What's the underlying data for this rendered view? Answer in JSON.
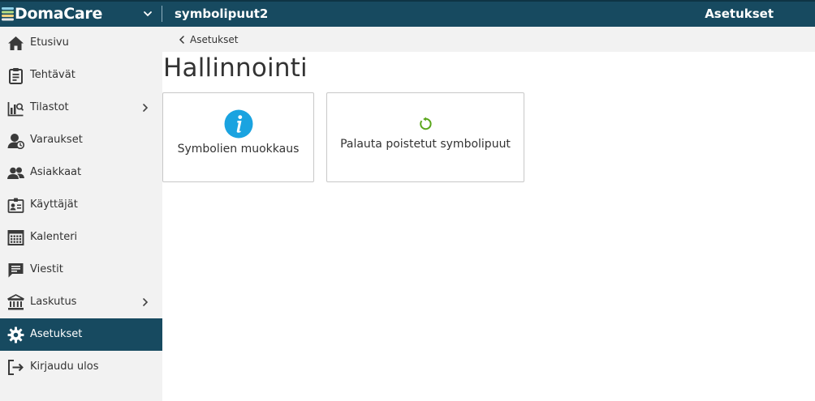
{
  "header": {
    "brand": "DomaCare",
    "organization": "symbolipuut2",
    "page": "Asetukset",
    "brand_icon": "stacked-layers-logo",
    "menu_icon": "chevron-down-icon"
  },
  "sidebar": {
    "items": [
      {
        "label": "Etusivu",
        "icon": "home-icon"
      },
      {
        "label": "Tehtävät",
        "icon": "clipboard-icon"
      },
      {
        "label": "Tilastot",
        "icon": "chart-icon",
        "has_submenu": true
      },
      {
        "label": "Varaukset",
        "icon": "user-clock-icon"
      },
      {
        "label": "Asiakkaat",
        "icon": "users-icon"
      },
      {
        "label": "Käyttäjät",
        "icon": "id-badge-icon"
      },
      {
        "label": "Kalenteri",
        "icon": "calendar-icon"
      },
      {
        "label": "Viestit",
        "icon": "message-icon"
      },
      {
        "label": "Laskutus",
        "icon": "bank-icon",
        "has_submenu": true
      },
      {
        "label": "Asetukset",
        "icon": "gear-icon",
        "active": true
      },
      {
        "label": "Kirjaudu ulos",
        "icon": "logout-icon"
      }
    ]
  },
  "breadcrumb": {
    "label": "Asetukset"
  },
  "main": {
    "title": "Hallinnointi",
    "cards": [
      {
        "label": "Symbolien muokkaus",
        "icon": "info-icon"
      },
      {
        "label": "Palauta poistetut symbolipuut",
        "icon": "restore-icon"
      }
    ]
  },
  "colors": {
    "topbar": "#174a60",
    "sidebar_bg": "#f2f2f2",
    "active_item": "#174a60",
    "info_blue": "#1aa3e0",
    "restore_green": "#5aa61b"
  }
}
